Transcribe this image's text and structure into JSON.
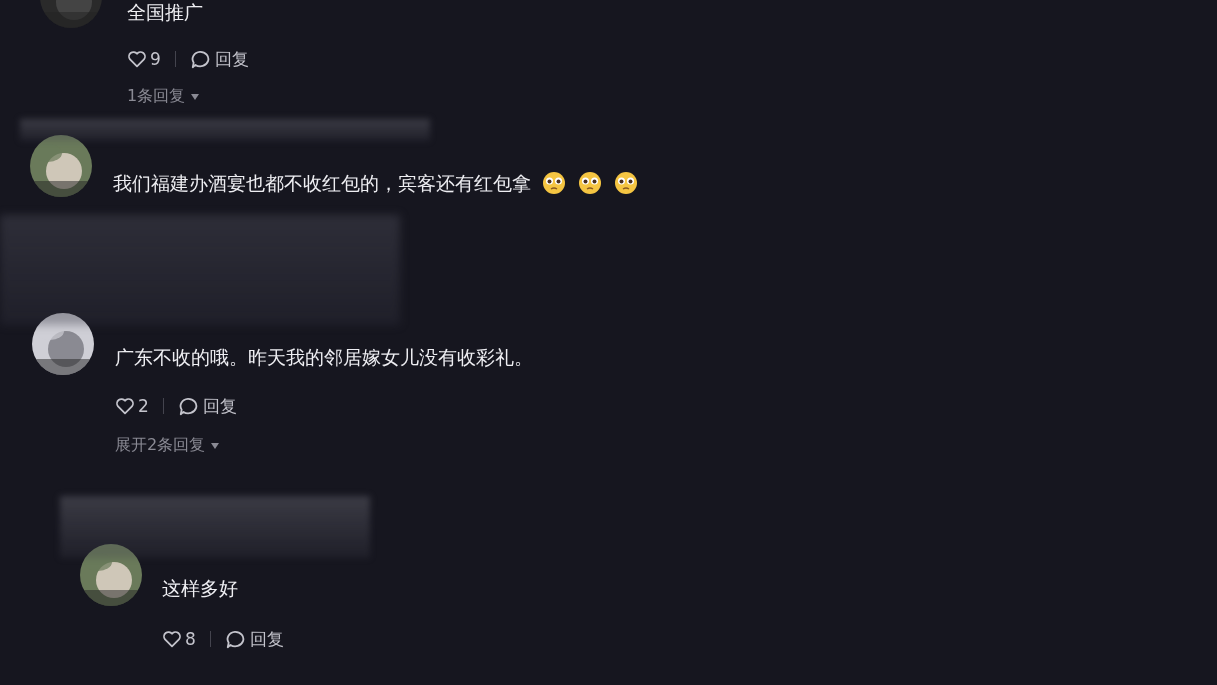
{
  "comments": [
    {
      "text": "全国推广",
      "like_count": "9",
      "reply_label": "回复",
      "expand_label": "1条回复",
      "blurred_name": false
    },
    {
      "text": "我们福建办酒宴也都不收红包的，宾客还有红包拿",
      "blurred_name": true,
      "emojis": [
        {
          "kind": "pleading"
        },
        {
          "kind": "pleading"
        },
        {
          "kind": "pleading"
        }
      ]
    },
    {
      "kind": "blurred"
    },
    {
      "text": "广东不收的哦。昨天我的邻居嫁女儿没有收彩礼。",
      "like_count": "2",
      "reply_label": "回复",
      "expand_label": "展开2条回复",
      "blurred_name": false,
      "replies": [
        {
          "text": "这样多好",
          "like_count": "8",
          "reply_label": "回复",
          "blurred_name": true
        }
      ]
    }
  ]
}
